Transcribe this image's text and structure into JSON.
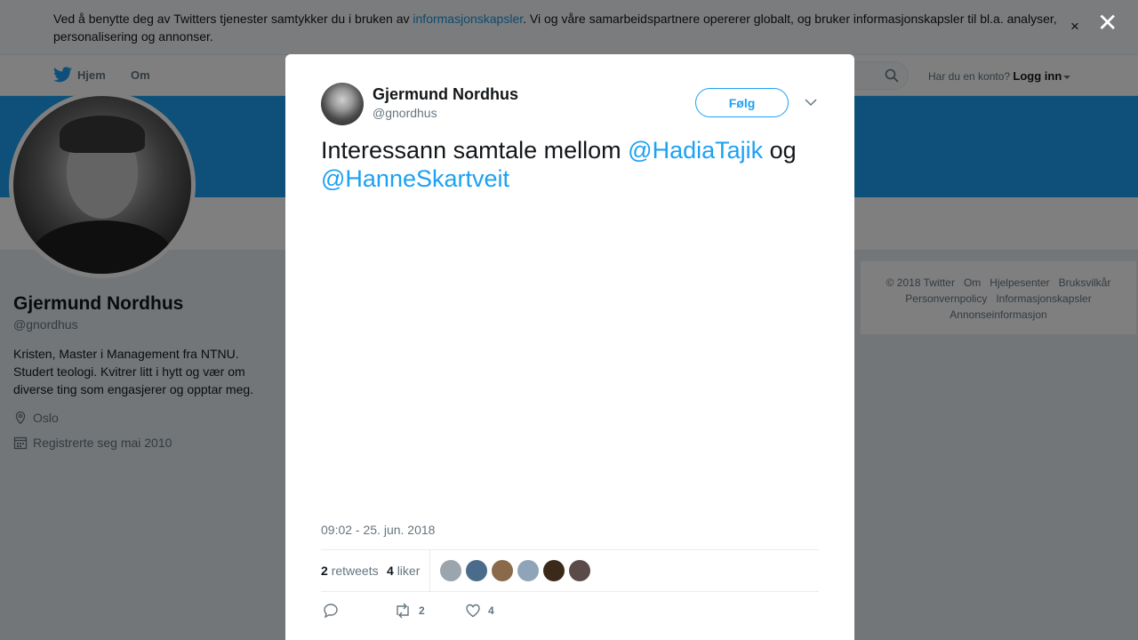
{
  "cookie_banner": {
    "text_before": "Ved å benytte deg av Twitters tjenester samtykker du i bruken av ",
    "link": "informasjonskapsler",
    "text_after": ". Vi og våre samarbeidspartnere opererer globalt, og bruker informasjonskapsler til bl.a. analyser, personalisering og annonser.",
    "close_glyph": "×"
  },
  "nav": {
    "home": "Hjem",
    "about": "Om",
    "login_prompt": "Har du en konto?",
    "login": "Logg inn"
  },
  "profile": {
    "name": "Gjermund Nordhus",
    "handle": "@gnordhus",
    "bio": "Kristen, Master i Management fra NTNU. Studert teologi. Kvitrer litt i hytt og vær om diverse ting som engasjerer og opptar meg.",
    "location": "Oslo",
    "joined": "Registrerte seg mai 2010"
  },
  "footer": {
    "links": [
      "© 2018 Twitter",
      "Om",
      "Hjelpesenter",
      "Bruksvilkår",
      "Personvernpolicy",
      "Informasjonskapsler",
      "Annonseinformasjon"
    ]
  },
  "overlay": {
    "close_glyph": "✕"
  },
  "tweet": {
    "author_name": "Gjermund Nordhus",
    "author_handle": "@gnordhus",
    "follow_label": "Følg",
    "text_1": "Interessann samtale mellom ",
    "mention_1": "@HadiaTajik",
    "text_2": " og ",
    "mention_2": "@HanneSkartveit",
    "timestamp": "09:02 - 25. jun. 2018",
    "retweets_count": "2",
    "retweets_label": "retweets",
    "likes_count": "4",
    "likes_label": "liker",
    "action_retweet_count": "2",
    "action_like_count": "4",
    "liker_colors": [
      "#9aa5ad",
      "#4a6b8a",
      "#8a6a4a",
      "#8fa4b8",
      "#3b2a1a",
      "#5a4a4a"
    ]
  },
  "colors": {
    "accent": "#1da1f2",
    "cover": "#1da1f2"
  }
}
